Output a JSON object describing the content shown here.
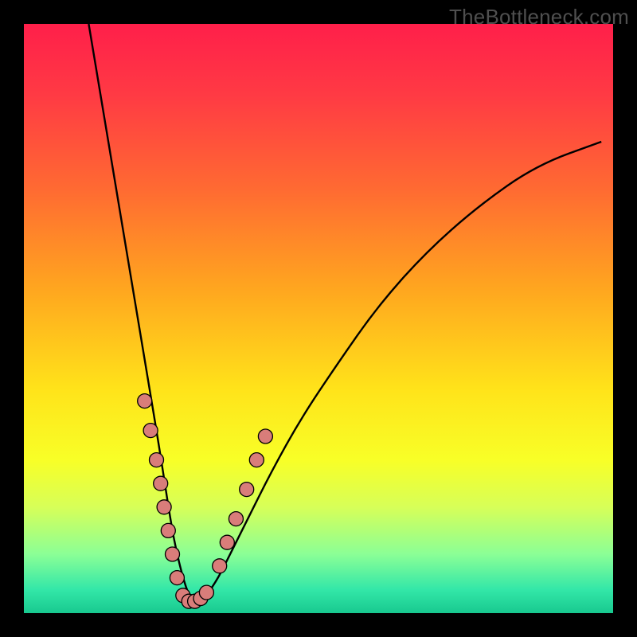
{
  "watermark": "TheBottleneck.com",
  "colors": {
    "frame": "#000000",
    "curve": "#000000",
    "marker_fill": "#d97d7a",
    "marker_stroke": "#000000",
    "gradient_stops": [
      {
        "offset": 0.0,
        "color": "#ff1f4a"
      },
      {
        "offset": 0.12,
        "color": "#ff3a44"
      },
      {
        "offset": 0.28,
        "color": "#ff6a32"
      },
      {
        "offset": 0.45,
        "color": "#ffa61f"
      },
      {
        "offset": 0.62,
        "color": "#ffe31a"
      },
      {
        "offset": 0.74,
        "color": "#f8ff27"
      },
      {
        "offset": 0.82,
        "color": "#d7ff58"
      },
      {
        "offset": 0.9,
        "color": "#8bff96"
      },
      {
        "offset": 0.96,
        "color": "#33e7a8"
      },
      {
        "offset": 1.0,
        "color": "#18c98f"
      }
    ]
  },
  "chart_data": {
    "type": "line",
    "title": "",
    "xlabel": "",
    "ylabel": "",
    "xlim": [
      0,
      100
    ],
    "ylim": [
      0,
      100
    ],
    "notes": "V-shaped bottleneck curve. Axes and ticks are hidden; background is a red→yellow→green vertical gradient. The black curve descends steeply from top-left, reaches a wide minimum around x≈28, then rises as a gentle convex arc toward upper-right. Clustered salmon markers highlight points near the trough and just above it on both arms.",
    "series": [
      {
        "name": "bottleneck-curve",
        "x": [
          11,
          13,
          15,
          17,
          19,
          21,
          23,
          25,
          26,
          27,
          28,
          29,
          30,
          31,
          33,
          35,
          38,
          42,
          47,
          53,
          60,
          68,
          77,
          87,
          98
        ],
        "y": [
          100,
          88,
          76,
          64,
          52,
          40,
          28,
          15,
          10,
          6,
          3,
          2,
          2,
          3,
          6,
          10,
          16,
          24,
          33,
          42,
          52,
          61,
          69,
          76,
          80
        ]
      }
    ],
    "markers": [
      {
        "x": 20.5,
        "y": 36
      },
      {
        "x": 21.5,
        "y": 31
      },
      {
        "x": 22.5,
        "y": 26
      },
      {
        "x": 23.2,
        "y": 22
      },
      {
        "x": 23.8,
        "y": 18
      },
      {
        "x": 24.5,
        "y": 14
      },
      {
        "x": 25.2,
        "y": 10
      },
      {
        "x": 26.0,
        "y": 6
      },
      {
        "x": 27.0,
        "y": 3
      },
      {
        "x": 28.0,
        "y": 2
      },
      {
        "x": 29.0,
        "y": 2
      },
      {
        "x": 30.0,
        "y": 2.5
      },
      {
        "x": 31.0,
        "y": 3.5
      },
      {
        "x": 33.2,
        "y": 8
      },
      {
        "x": 34.5,
        "y": 12
      },
      {
        "x": 36.0,
        "y": 16
      },
      {
        "x": 37.8,
        "y": 21
      },
      {
        "x": 39.5,
        "y": 26
      },
      {
        "x": 41.0,
        "y": 30
      }
    ]
  }
}
